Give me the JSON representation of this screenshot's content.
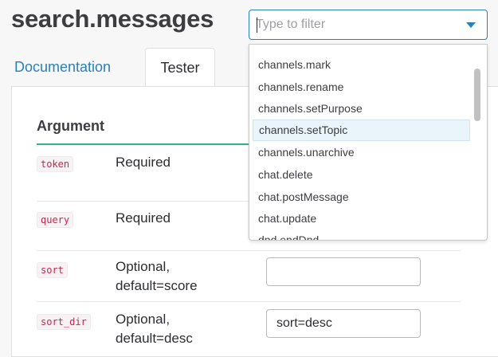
{
  "page": {
    "title": "search.messages"
  },
  "tabs": [
    {
      "label": "Documentation",
      "active": false
    },
    {
      "label": "Tester",
      "active": true
    }
  ],
  "table": {
    "header": "Argument",
    "rows": [
      {
        "name": "token",
        "requirement": "Required",
        "requirement_line2": "",
        "value": ""
      },
      {
        "name": "query",
        "requirement": "Required",
        "requirement_line2": "",
        "value": ""
      },
      {
        "name": "sort",
        "requirement": "Optional,",
        "requirement_line2": "default=score",
        "value": ""
      },
      {
        "name": "sort_dir",
        "requirement": "Optional,",
        "requirement_line2": "default=desc",
        "value": "sort=desc"
      }
    ]
  },
  "method_filter": {
    "placeholder": "Type to filter",
    "value": "",
    "options": [
      "channels.mark",
      "channels.rename",
      "channels.setPurpose",
      "channels.setTopic",
      "channels.unarchive",
      "chat.delete",
      "chat.postMessage",
      "chat.update",
      "dnd.endDnd"
    ],
    "highlighted": "channels.setTopic"
  },
  "colors": {
    "accent": "#2a80b9",
    "header_rule": "#2eb67d",
    "code_text": "#c7254e"
  }
}
